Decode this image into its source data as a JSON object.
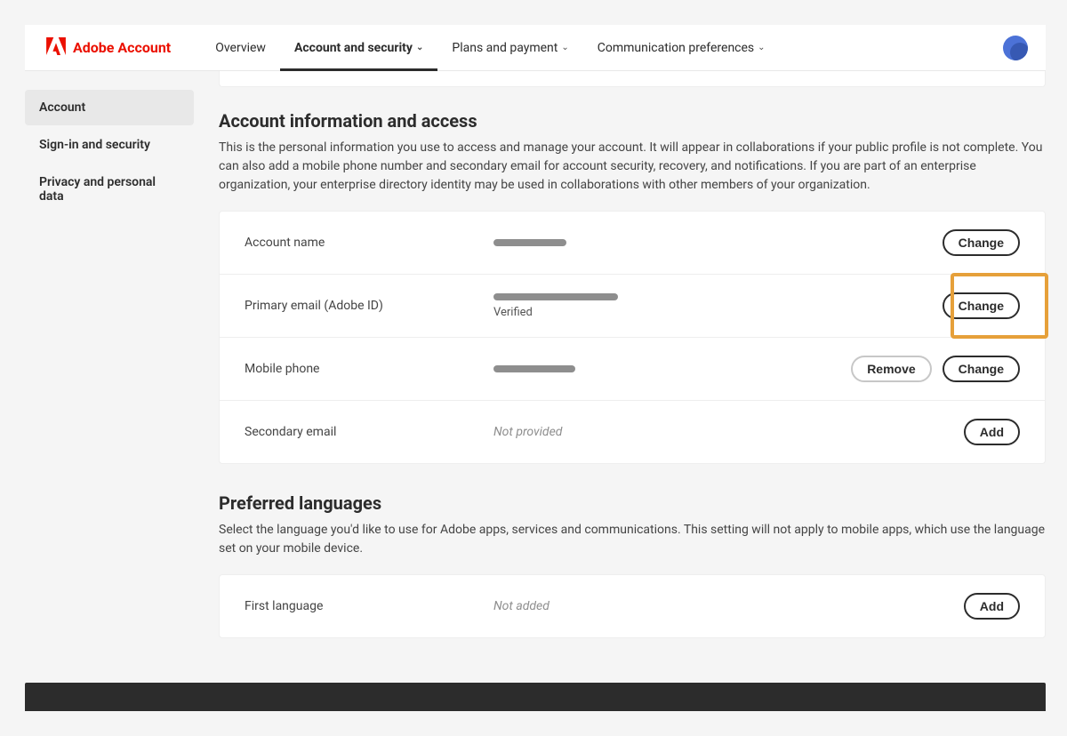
{
  "brand": {
    "name": "Adobe Account"
  },
  "nav": {
    "overview": "Overview",
    "account_security": "Account and security",
    "plans_payment": "Plans and payment",
    "communication": "Communication preferences"
  },
  "sidebar": {
    "account": "Account",
    "signin_security": "Sign-in and security",
    "privacy": "Privacy and personal data"
  },
  "account_info": {
    "title": "Account information and access",
    "description": "This is the personal information you use to access and manage your account. It will appear in collaborations if your public profile is not complete. You can also add a mobile phone number and secondary email for account security, recovery, and notifications. If you are part of an enterprise organization, your enterprise directory identity may be used in collaborations with other members of your organization.",
    "rows": {
      "account_name": {
        "label": "Account name",
        "action": "Change"
      },
      "primary_email": {
        "label": "Primary email (Adobe ID)",
        "status": "Verified",
        "action": "Change"
      },
      "mobile_phone": {
        "label": "Mobile phone",
        "remove": "Remove",
        "change": "Change"
      },
      "secondary_email": {
        "label": "Secondary email",
        "value": "Not provided",
        "action": "Add"
      }
    }
  },
  "languages": {
    "title": "Preferred languages",
    "description": "Select the language you'd like to use for Adobe apps, services and communications. This setting will not apply to mobile apps, which use the language set on your mobile device.",
    "rows": {
      "first_language": {
        "label": "First language",
        "value": "Not added",
        "action": "Add"
      }
    }
  }
}
